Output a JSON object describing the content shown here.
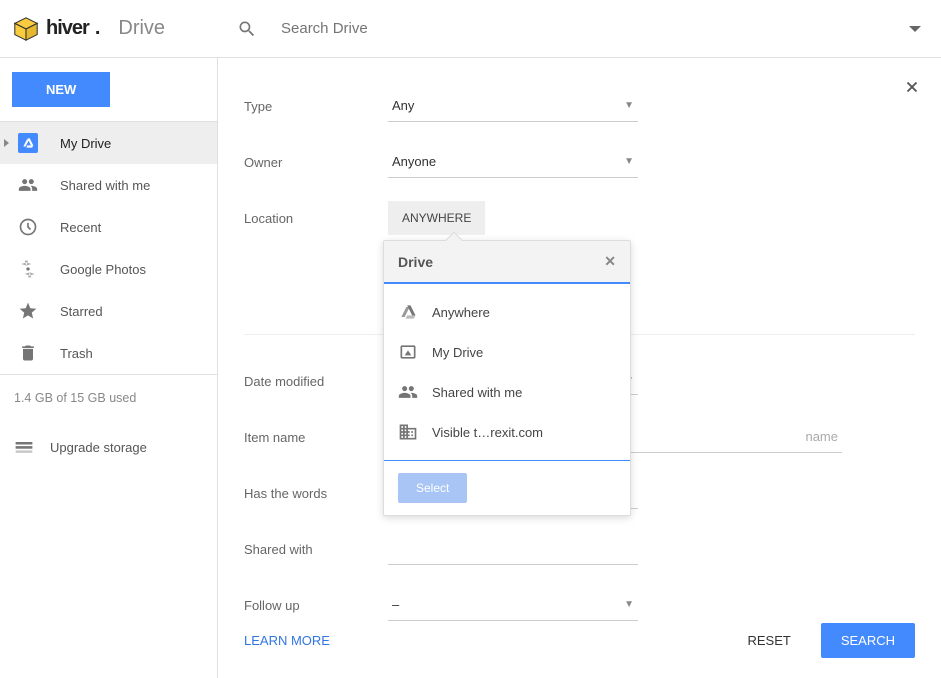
{
  "header": {
    "brand": "hiver",
    "app": "Drive",
    "search_placeholder": "Search Drive"
  },
  "sidebar": {
    "new_label": "NEW",
    "items": [
      {
        "label": "My Drive",
        "icon": "drive-icon",
        "active": true
      },
      {
        "label": "Shared with me",
        "icon": "people-icon"
      },
      {
        "label": "Recent",
        "icon": "clock-icon"
      },
      {
        "label": "Google Photos",
        "icon": "photos-icon"
      },
      {
        "label": "Starred",
        "icon": "star-icon"
      },
      {
        "label": "Trash",
        "icon": "trash-icon"
      }
    ],
    "storage": "1.4 GB of 15 GB used",
    "upgrade": "Upgrade storage"
  },
  "form": {
    "type": {
      "label": "Type",
      "value": "Any"
    },
    "owner": {
      "label": "Owner",
      "value": "Anyone"
    },
    "location": {
      "label": "Location",
      "value": "ANYWHERE"
    },
    "date_modified": {
      "label": "Date modified",
      "value": ""
    },
    "item_name": {
      "label": "Item name",
      "placeholder": "name"
    },
    "has_words": {
      "label": "Has the words",
      "placeholder": ""
    },
    "shared_with": {
      "label": "Shared with",
      "placeholder": ""
    },
    "follow_up": {
      "label": "Follow up",
      "value": "–"
    }
  },
  "popover": {
    "title": "Drive",
    "items": [
      {
        "label": "Anywhere",
        "icon": "drive-triangle-icon"
      },
      {
        "label": "My Drive",
        "icon": "mydrive-icon"
      },
      {
        "label": "Shared with me",
        "icon": "people-icon"
      },
      {
        "label": "Visible t…rexit.com",
        "icon": "domain-icon"
      }
    ],
    "select_label": "Select"
  },
  "footer": {
    "learn_more": "LEARN MORE",
    "reset": "RESET",
    "search": "SEARCH"
  }
}
